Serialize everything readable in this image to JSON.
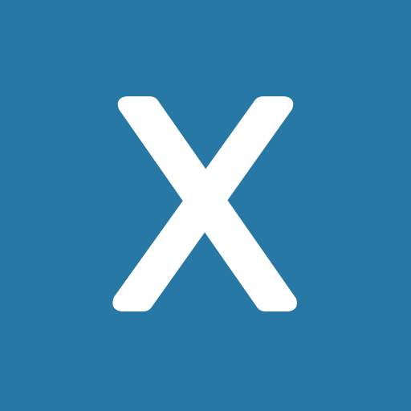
{
  "icon": {
    "name": "x-letter-icon",
    "letter": "X",
    "background_color": "#2878a5",
    "glyph_color": "#ffffff"
  }
}
